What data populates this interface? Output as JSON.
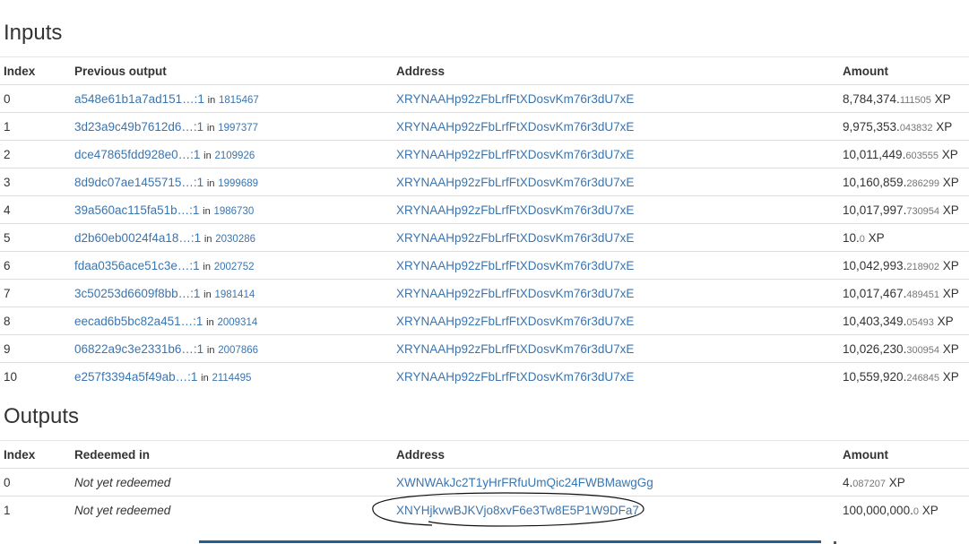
{
  "inputs": {
    "title": "Inputs",
    "headers": {
      "index": "Index",
      "previous_output": "Previous output",
      "address": "Address",
      "amount": "Amount"
    },
    "in_label": "in",
    "rows": [
      {
        "index": "0",
        "prev": "a548e61b1a7ad151…:1",
        "block": "1815467",
        "address": "XRYNAAHp92zFbLrfFtXDosvKm76r3dU7xE",
        "amount_int": "8,784,374.",
        "amount_frac": "111505",
        "unit": " XP"
      },
      {
        "index": "1",
        "prev": "3d23a9c49b7612d6…:1",
        "block": "1997377",
        "address": "XRYNAAHp92zFbLrfFtXDosvKm76r3dU7xE",
        "amount_int": "9,975,353.",
        "amount_frac": "043832",
        "unit": " XP"
      },
      {
        "index": "2",
        "prev": "dce47865fdd928e0…:1",
        "block": "2109926",
        "address": "XRYNAAHp92zFbLrfFtXDosvKm76r3dU7xE",
        "amount_int": "10,011,449.",
        "amount_frac": "603555",
        "unit": " XP"
      },
      {
        "index": "3",
        "prev": "8d9dc07ae1455715…:1",
        "block": "1999689",
        "address": "XRYNAAHp92zFbLrfFtXDosvKm76r3dU7xE",
        "amount_int": "10,160,859.",
        "amount_frac": "286299",
        "unit": " XP"
      },
      {
        "index": "4",
        "prev": "39a560ac115fa51b…:1",
        "block": "1986730",
        "address": "XRYNAAHp92zFbLrfFtXDosvKm76r3dU7xE",
        "amount_int": "10,017,997.",
        "amount_frac": "730954",
        "unit": " XP"
      },
      {
        "index": "5",
        "prev": "d2b60eb0024f4a18…:1",
        "block": "2030286",
        "address": "XRYNAAHp92zFbLrfFtXDosvKm76r3dU7xE",
        "amount_int": "10.",
        "amount_frac": "0",
        "unit": " XP"
      },
      {
        "index": "6",
        "prev": "fdaa0356ace51c3e…:1",
        "block": "2002752",
        "address": "XRYNAAHp92zFbLrfFtXDosvKm76r3dU7xE",
        "amount_int": "10,042,993.",
        "amount_frac": "218902",
        "unit": " XP"
      },
      {
        "index": "7",
        "prev": "3c50253d6609f8bb…:1",
        "block": "1981414",
        "address": "XRYNAAHp92zFbLrfFtXDosvKm76r3dU7xE",
        "amount_int": "10,017,467.",
        "amount_frac": "489451",
        "unit": " XP"
      },
      {
        "index": "8",
        "prev": "eecad6b5bc82a451…:1",
        "block": "2009314",
        "address": "XRYNAAHp92zFbLrfFtXDosvKm76r3dU7xE",
        "amount_int": "10,403,349.",
        "amount_frac": "05493",
        "unit": " XP"
      },
      {
        "index": "9",
        "prev": "06822a9c3e2331b6…:1",
        "block": "2007866",
        "address": "XRYNAAHp92zFbLrfFtXDosvKm76r3dU7xE",
        "amount_int": "10,026,230.",
        "amount_frac": "300954",
        "unit": " XP"
      },
      {
        "index": "10",
        "prev": "e257f3394a5f49ab…:1",
        "block": "2114495",
        "address": "XRYNAAHp92zFbLrfFtXDosvKm76r3dU7xE",
        "amount_int": "10,559,920.",
        "amount_frac": "246845",
        "unit": " XP"
      }
    ]
  },
  "outputs": {
    "title": "Outputs",
    "headers": {
      "index": "Index",
      "redeemed_in": "Redeemed in",
      "address": "Address",
      "amount": "Amount"
    },
    "rows": [
      {
        "index": "0",
        "redeemed": "Not yet redeemed",
        "address": "XWNWAkJc2T1yHrFRfuUmQic24FWBMawgGg",
        "amount_int": "4.",
        "amount_frac": "087207",
        "unit": " XP"
      },
      {
        "index": "1",
        "redeemed": "Not yet redeemed",
        "address": "XNYHjkvwBJKVjo8xvF6e3Tw8E5P1W9DFa7",
        "amount_int": "100,000,000.",
        "amount_frac": "0",
        "unit": " XP"
      }
    ]
  },
  "colors": {
    "link": "#3a75b0",
    "text": "#333333",
    "border": "#dddddd",
    "annotation": "#111111"
  }
}
